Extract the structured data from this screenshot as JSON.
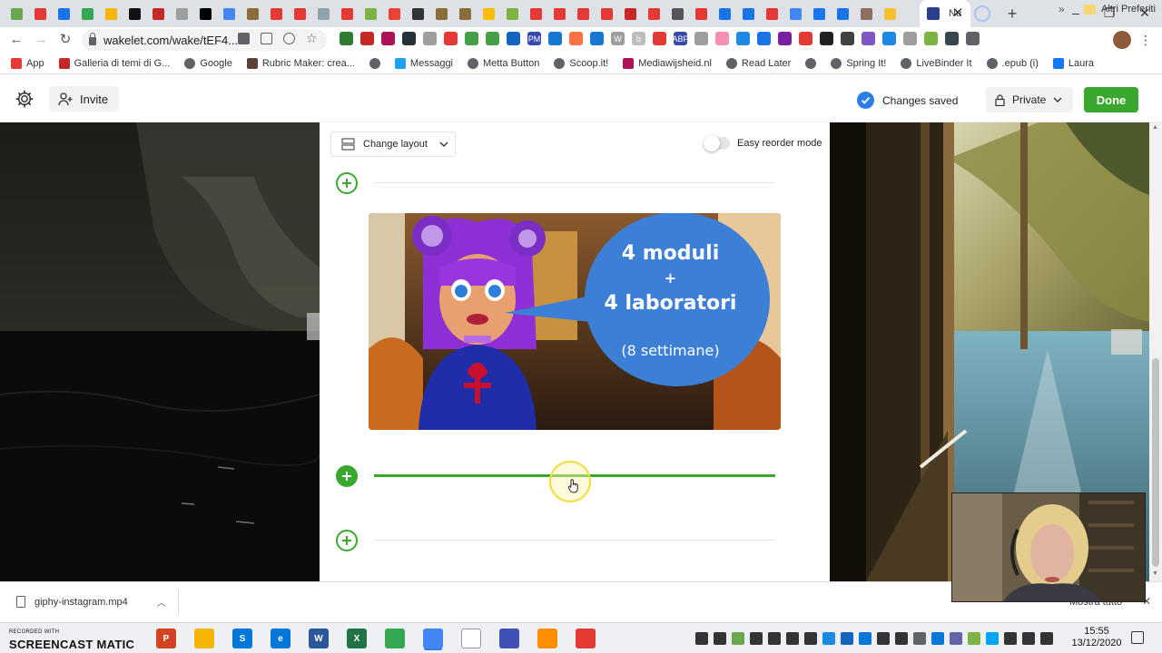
{
  "browser": {
    "active_tab_title": "Nu",
    "url": "wakelet.com/wake/tEF4...",
    "tab_favicons": [
      "#6aa84f",
      "#e53935",
      "#1a73e8",
      "#34a853",
      "#f4b400",
      "#111111",
      "#c62828",
      "#9e9e9e",
      "#000000",
      "#4285f4",
      "#8a6d3b",
      "#e53935",
      "#e53935",
      "#90a4ae",
      "#e53935",
      "#7cb342",
      "#ea4335",
      "#333333",
      "#8a6d3b",
      "#8a6d3b",
      "#fbbc04",
      "#7cb342",
      "#e53935",
      "#e53935",
      "#e53935",
      "#e53935",
      "#c62828",
      "#e53935",
      "#555555",
      "#e53935",
      "#1a73e8",
      "#1a73e8",
      "#e53935",
      "#4285f4",
      "#1877f2",
      "#1a73e8",
      "#8d6e63",
      "#fbc02d"
    ],
    "extension_colors": [
      "#2e7d32",
      "#c62828",
      "#ad1457",
      "#263238",
      "#9e9e9e",
      "#e53935",
      "#43a047",
      "#43a047",
      "#1565c0",
      "#3949ab",
      "#1976d2",
      "#ff7043",
      "#1976d2",
      "#9e9e9e",
      "#bdbdbd",
      "#e53935",
      "#3949ab",
      "#9e9e9e",
      "#f48fb1",
      "#1e88e5",
      "#1a73e8",
      "#7b1fa2",
      "#e53935",
      "#212121",
      "#424242",
      "#7e57c2",
      "#1e88e5",
      "#9e9e9e",
      "#7cb342",
      "#37474f",
      "#5f6368"
    ],
    "extension_labels": {
      "pm": "PM",
      "w": "W",
      "b": "b",
      "abp": "ABP"
    }
  },
  "bookmarks": {
    "items": [
      {
        "label": "App",
        "icon": "apps-grid-icon",
        "color": "#e53935"
      },
      {
        "label": "Galleria di temi di G...",
        "icon": "chrome-icon",
        "color": "#c62828"
      },
      {
        "label": "Google",
        "icon": "globe-icon",
        "color": "#5f6368"
      },
      {
        "label": "Rubric Maker: crea...",
        "icon": "rubric-icon",
        "color": "#5d4037"
      },
      {
        "label": "",
        "icon": "globe-icon",
        "color": "#5f6368"
      },
      {
        "label": "Messaggi",
        "icon": "twitter-icon",
        "color": "#1da1f2"
      },
      {
        "label": "Metta Button",
        "icon": "globe-icon",
        "color": "#5f6368"
      },
      {
        "label": "Scoop.it!",
        "icon": "globe-icon",
        "color": "#5f6368"
      },
      {
        "label": "Mediawijsheid.nl",
        "icon": "mediawijsheid-icon",
        "color": "#ad1457"
      },
      {
        "label": "Read Later",
        "icon": "globe-icon",
        "color": "#5f6368"
      },
      {
        "label": "",
        "icon": "globe-icon",
        "color": "#5f6368"
      },
      {
        "label": "Spring It!",
        "icon": "globe-icon",
        "color": "#5f6368"
      },
      {
        "label": "LiveBinder It",
        "icon": "globe-icon",
        "color": "#5f6368"
      },
      {
        "label": ".epub (i)",
        "icon": "globe-icon",
        "color": "#5f6368"
      },
      {
        "label": "Laura",
        "icon": "facebook-icon",
        "color": "#1877f2"
      }
    ],
    "more": "»",
    "other_label": "Altri Preferiti"
  },
  "wakelet": {
    "invite_label": "Invite",
    "saved_label": "Changes saved",
    "privacy_label": "Private",
    "done_label": "Done",
    "change_layout_label": "Change layout",
    "reorder_label": "Easy reorder mode",
    "reorder_enabled": false,
    "media_text": {
      "line1": "4 moduli",
      "plus": "+",
      "line2": "4 laboratori",
      "line3": "(8 settimane)"
    },
    "accent": "#3aa82e",
    "saved_color": "#2d7ee8"
  },
  "download": {
    "file_name": "giphy-instagram.mp4",
    "show_all_label": "Mostra tutto"
  },
  "taskbar": {
    "watermark_small": "RECORDED WITH",
    "watermark_main": "SCREENCAST MATIC",
    "app_colors": [
      "#d04423",
      "#f4b400",
      "#0078d7",
      "#0078d7",
      "#2b579a",
      "#217346",
      "#34a853",
      "#4285f4",
      "#ffffff",
      "#3f51b5",
      "#ff8f00",
      "#e53935"
    ],
    "app_labels": [
      "P",
      "",
      "S",
      "e",
      "W",
      "X",
      "",
      "",
      "",
      "",
      "",
      ""
    ],
    "tray_colors": [
      "#333333",
      "#333333",
      "#6aa84f",
      "#333333",
      "#333333",
      "#333333",
      "#333333",
      "#1e88e5",
      "#1565c0",
      "#0078d7",
      "#333333",
      "#333333",
      "#5f6368",
      "#0078d7",
      "#6264a7",
      "#7cb342",
      "#00a4ef",
      "#333333",
      "#333333",
      "#333333"
    ],
    "time": "15:55",
    "date": "13/12/2020"
  }
}
